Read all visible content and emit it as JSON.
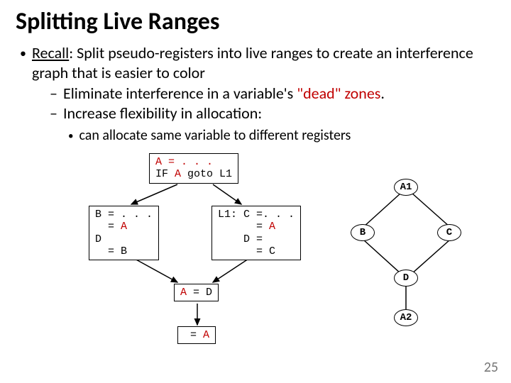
{
  "title": "Splitting Live Ranges",
  "recall_label": "Recall",
  "recall_text": ": Split pseudo-registers into live ranges to create an interference graph that is easier to color",
  "sub_elim_pre": "Eliminate interference in a variable's ",
  "sub_elim_red": "\"dead\" zones",
  "sub_elim_post": ".",
  "sub_flex": "Increase flexibility in allocation:",
  "sub_alloc": "can allocate same variable to different registers",
  "code_top_l1": "A = . . .",
  "code_top_l2": "IF A goto L1",
  "code_left_l1": "B = . . .",
  "code_left_l2": "  = A",
  "code_left_l3": "D",
  "code_left_l4": "  = B",
  "code_right_l1": "L1: C =. . .",
  "code_right_l2": "      = A",
  "code_right_l3": "    D =",
  "code_right_l4": "      = C",
  "code_mid": "A = D",
  "code_bot": " = A",
  "node_a1": "A1",
  "node_b": "B",
  "node_c": "C",
  "node_d": "D",
  "node_a2": "A2",
  "pagenum": "25"
}
